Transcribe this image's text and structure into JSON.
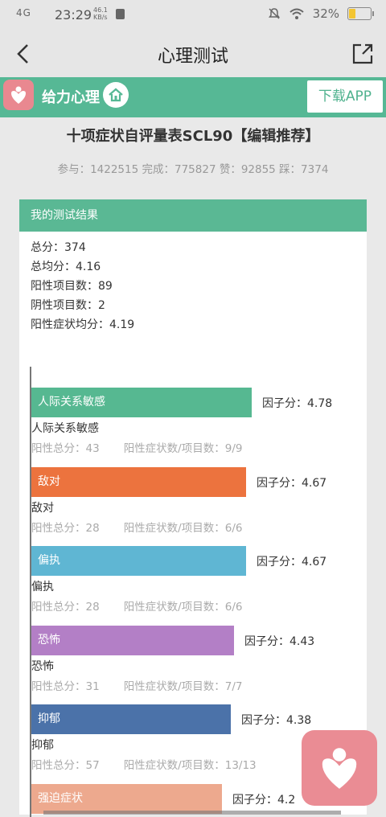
{
  "status": {
    "signal": "4G",
    "time": "23:29",
    "net_speed_value": "46.1",
    "net_speed_unit": "KB/s",
    "battery": "32%",
    "battery_level": 0.32
  },
  "nav": {
    "title": "心理测试"
  },
  "brand": {
    "name": "给力心理",
    "download": "下载APP"
  },
  "page": {
    "title": "十项症状自评量表SCL90【编辑推荐】",
    "stats": "参与：1422515  完成：775827  赞：92855  踩：7374"
  },
  "result": {
    "header": "我的测试结果",
    "summary": [
      "总分：374",
      "总均分：4.16",
      "阳性项目数：89",
      "阴性项目数：2",
      "阳性症状均分：4.19"
    ]
  },
  "chart_data": {
    "type": "bar",
    "orientation": "horizontal",
    "max": 5,
    "categories": [
      "人际关系敏感",
      "敌对",
      "偏执",
      "恐怖",
      "抑郁",
      "强迫症状"
    ],
    "values": [
      4.78,
      4.67,
      4.67,
      4.43,
      4.38,
      4.2
    ],
    "value_prefix": "因子分：",
    "colors": [
      "#56b891",
      "#ec733e",
      "#5fb6d3",
      "#b37fc6",
      "#4b72a9",
      "#eda98e"
    ],
    "details": [
      {
        "pos_total": "阳性总分：43",
        "ratio": "阳性症状数/项目数：9/9"
      },
      {
        "pos_total": "阳性总分：28",
        "ratio": "阳性症状数/项目数：6/6"
      },
      {
        "pos_total": "阳性总分：28",
        "ratio": "阳性症状数/项目数：6/6"
      },
      {
        "pos_total": "阳性总分：31",
        "ratio": "阳性症状数/项目数：7/7"
      },
      {
        "pos_total": "阳性总分：57",
        "ratio": "阳性症状数/项目数：13/13"
      },
      {
        "pos_total": "",
        "ratio": ""
      }
    ]
  }
}
